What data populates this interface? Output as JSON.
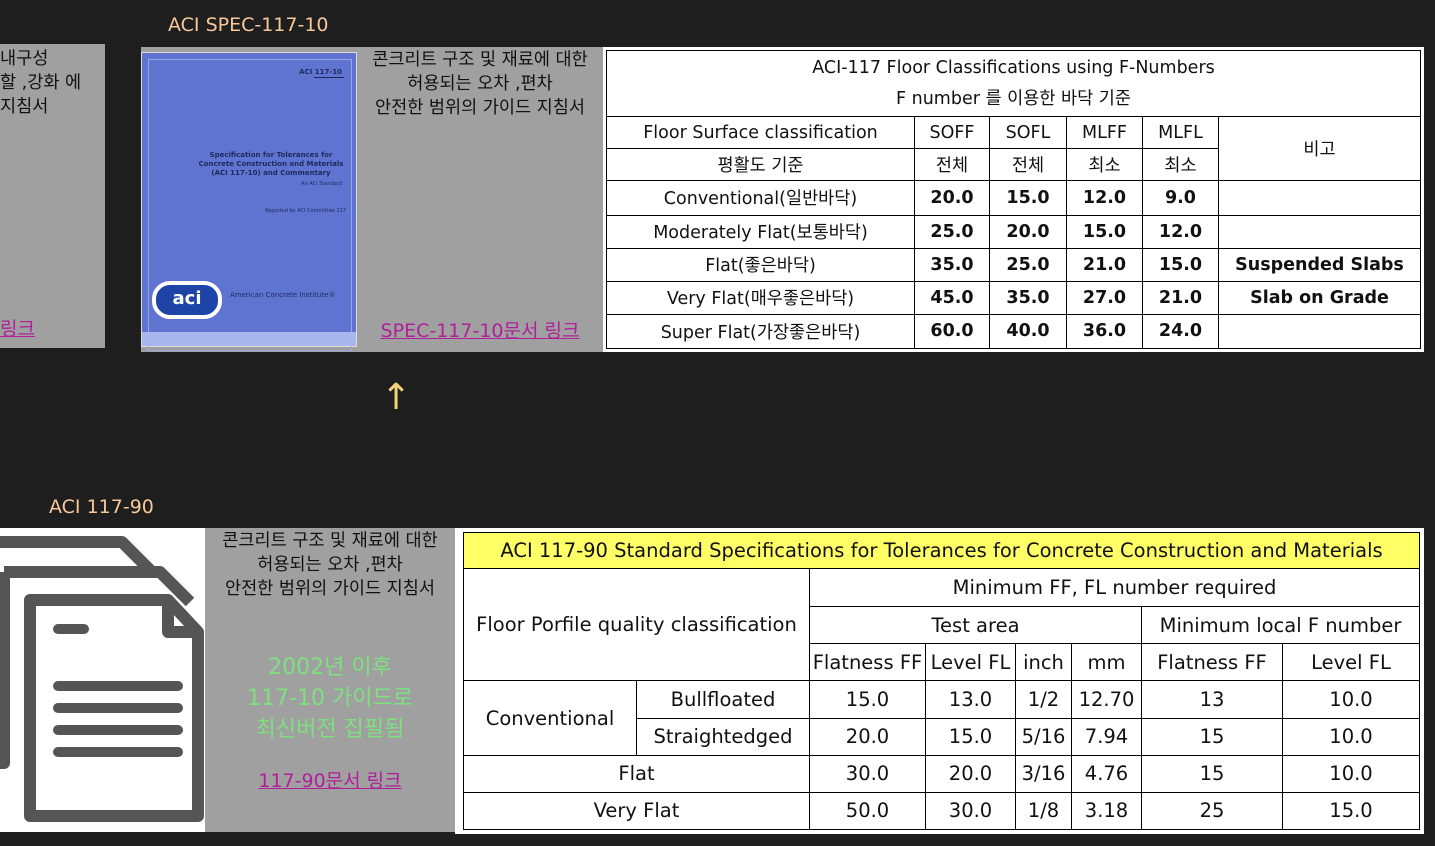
{
  "top": {
    "label": "ACI SPEC-117-10",
    "left_partial_text": [
      "내구성",
      "할 ,강화 에",
      "지침서"
    ],
    "left_partial_link": "링크",
    "cover": {
      "code": "ACI 117-10",
      "title_lines": [
        "Specification for Tolerances for",
        "Concrete Construction and Materials",
        "(ACI 117-10) and Commentary"
      ],
      "subtitle": "An ACI Standard",
      "reported": "Reported by ACI Committee 117",
      "logo": "aci",
      "institute": "American Concrete Institute®"
    },
    "desc_lines": [
      "콘크리트 구조 및 재료에 대한",
      "허용되는 오차 ,편차",
      "안전한 범위의 가이드 지침서"
    ],
    "link": "SPEC-117-10문서 링크",
    "table": {
      "title1": "ACI-117 Floor Classifications using F-Numbers",
      "title2": "F number 를 이용한 바닥 기준",
      "h1": [
        "Floor Surface classification",
        "SOFF",
        "SOFL",
        "MLFF",
        "MLFL",
        "비고"
      ],
      "h2": [
        "평활도 기준",
        "전체",
        "전체",
        "최소",
        "최소"
      ],
      "rows": [
        [
          "Conventional(일반바닥)",
          "20.0",
          "15.0",
          "12.0",
          "9.0",
          ""
        ],
        [
          "Moderately Flat(보통바닥)",
          "25.0",
          "20.0",
          "15.0",
          "12.0",
          ""
        ],
        [
          "Flat(좋은바닥)",
          "35.0",
          "25.0",
          "21.0",
          "15.0",
          "Suspended Slabs"
        ],
        [
          "Very Flat(매우좋은바닥)",
          "45.0",
          "35.0",
          "27.0",
          "21.0",
          "Slab on Grade"
        ],
        [
          "Super Flat(가장좋은바닥)",
          "60.0",
          "40.0",
          "36.0",
          "24.0",
          ""
        ]
      ]
    }
  },
  "arrow": "↑",
  "bottom": {
    "label": "ACI 117-90",
    "desc_lines": [
      "콘크리트 구조 및 재료에 대한",
      "허용되는 오차 ,편차",
      "안전한 범위의 가이드 지침서"
    ],
    "note_lines": [
      "2002년 이후",
      "117-10 가이드로",
      "최신버전 집필됨"
    ],
    "link": "117-90문서 링크",
    "icon": "documents-icon",
    "table": {
      "title": "ACI 117-90 Standard Specifications for Tolerances for Concrete Construction and Materials",
      "class_header": "Floor Porfile quality classification",
      "min_header": "Minimum FF, FL number required",
      "test_area": "Test area",
      "min_local": "Minimum local F number",
      "sub_headers": [
        "Flatness FF",
        "Level FL",
        "inch",
        "mm",
        "Flatness FF",
        "Level FL"
      ],
      "conventional": "Conventional",
      "rows": [
        {
          "name": "Bullfloated",
          "vals": [
            "15.0",
            "13.0",
            "1/2",
            "12.70",
            "13",
            "10.0"
          ]
        },
        {
          "name": "Straightedged",
          "vals": [
            "20.0",
            "15.0",
            "5/16",
            "7.94",
            "15",
            "10.0"
          ]
        },
        {
          "name": "Flat",
          "vals": [
            "30.0",
            "20.0",
            "3/16",
            "4.76",
            "15",
            "10.0"
          ]
        },
        {
          "name": "Very Flat",
          "vals": [
            "50.0",
            "30.0",
            "1/8",
            "3.18",
            "25",
            "15.0"
          ]
        }
      ]
    }
  },
  "colors": {
    "background": "#1e1e1e",
    "panel": "#a0a0a0",
    "label": "#f7c89a",
    "link": "#b0209a",
    "note": "#7ee07e",
    "title_fill": "#ffff66",
    "cover": "#5f74d0"
  }
}
